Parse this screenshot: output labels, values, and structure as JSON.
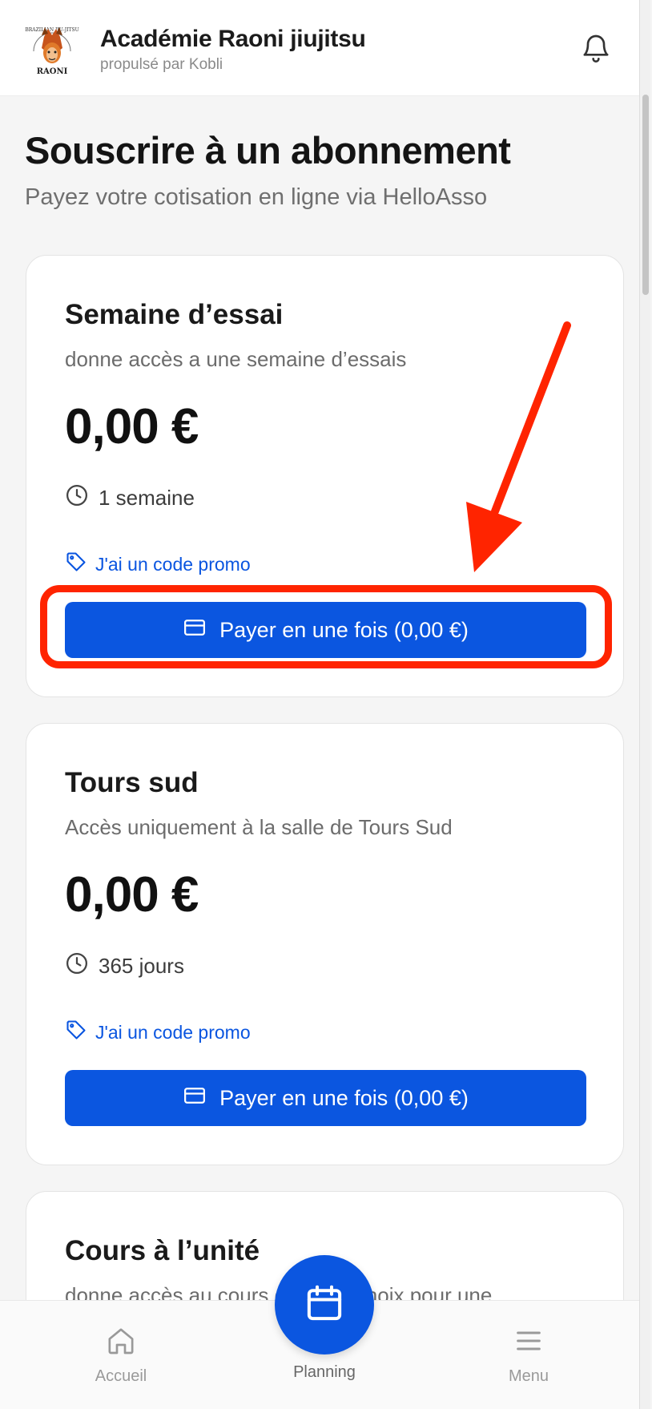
{
  "header": {
    "title": "Académie Raoni jiujitsu",
    "subtitle": "propulsé par Kobli",
    "logo_text_top": "BRAZILIAN JIU-JITSU",
    "logo_text_bottom": "RAONI"
  },
  "page": {
    "title": "Souscrire à un abonnement",
    "subtitle": "Payez votre cotisation en ligne via HelloAsso"
  },
  "plans": [
    {
      "title": "Semaine d’essai",
      "description": "donne accès a une semaine d’essais",
      "price": "0,00 €",
      "duration": "1 semaine",
      "promo_label": "J'ai un code promo",
      "pay_label": "Payer en une fois (0,00 €)"
    },
    {
      "title": "Tours sud",
      "description": "Accès uniquement à la salle de Tours Sud",
      "price": "0,00 €",
      "duration": "365 jours",
      "promo_label": "J'ai un code promo",
      "pay_label": "Payer en une fois (0,00 €)"
    },
    {
      "title": "Cours à l’unité",
      "description": "donne accès au cours de votre choix pour une"
    }
  ],
  "nav": {
    "home_label": "Accueil",
    "planning_label": "Planning",
    "menu_label": "Menu"
  },
  "icons": {
    "bell": "bell-icon",
    "clock": "clock-icon",
    "tag": "tag-icon",
    "card": "credit-card-icon",
    "home": "home-icon",
    "calendar": "calendar-icon",
    "menu": "hamburger-icon"
  },
  "colors": {
    "primary": "#0b56e0",
    "annotation": "#ff2400"
  }
}
